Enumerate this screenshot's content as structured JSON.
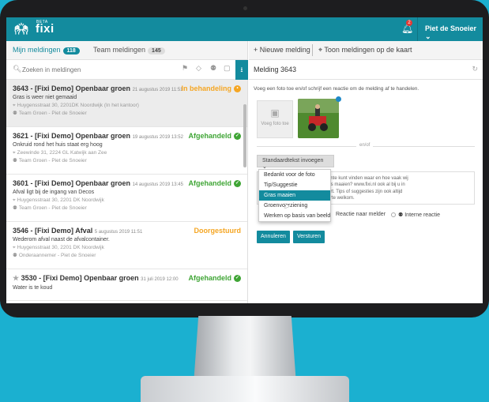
{
  "app": {
    "logo": "fixi",
    "beta": "BETA",
    "user": "Piet de Snoeier ⌄",
    "notification_count": "2"
  },
  "tabs": [
    {
      "label": "Mijn meldingen",
      "count": "118"
    },
    {
      "label": "Team meldingen",
      "count": "145"
    }
  ],
  "search": {
    "placeholder": "Zoeken in meldingen"
  },
  "items": [
    {
      "title": "3643 - [Fixi Demo] Openbaar groen",
      "date": "21 augustus 2019 11:51",
      "status": "In behandeling",
      "desc": "Gras is weer niet gemaaid",
      "address": "Huygensstraat 30, 2201DK Noordwijk (In het kantoor)",
      "team": "Team Groen - Piet de Snoeier"
    },
    {
      "title": "3621 - [Fixi Demo] Openbaar groen",
      "date": "19 augustus 2019 13:52",
      "status": "Afgehandeld",
      "desc": "Onkruid rond het huis staat erg hoog",
      "address": "Zeewinde 31, 2224 GL Katwijk aan Zee",
      "team": "Team Groen - Piet de Snoeier"
    },
    {
      "title": "3601 - [Fixi Demo] Openbaar groen",
      "date": "14 augustus 2019 13:45",
      "status": "Afgehandeld",
      "desc": "Afval ligt bij de ingang van Decos",
      "address": "Huygensstraat 30, 2201 DK Noordwijk",
      "team": "Team Groen - Piet de Snoeier"
    },
    {
      "title": "3546 - [Fixi Demo] Afval",
      "date": "5 augustus 2019 11:51",
      "status": "Doorgestuurd",
      "desc": "Wederom afval naast de afvalcontainer.",
      "address": "Huygensstraat 30, 2201 DK Noordwijk",
      "team": "Onderaannemer - Piet de Snoeier"
    },
    {
      "title": "3530 - [Fixi Demo] Openbaar groen",
      "date": "31 juli 2019 12:00",
      "status": "Afgehandeld",
      "desc": "Water is te koud",
      "address": "",
      "team": ""
    }
  ],
  "right": {
    "new_report": "Nieuwe melding",
    "show_map": "Toon meldingen op de kaart",
    "detail_title": "Melding 3643",
    "hint": "Voeg een foto toe en/of schrijf een reactie om de melding af te handelen.",
    "add_photo": "Voeg foto toe",
    "or": "en/of",
    "std_text": "Standaardtekst invoegen ⌄",
    "textarea_text": "gemeente kunt vinden waar en hoe vaak wij het gras maaien? www.fixi.nl ook al bij u in de buurt. Tips of suggesties zijn ook altijd van harte welkom.",
    "radio1": "Reactie naar melder",
    "radio2": "Interne reactie",
    "btn_annuleren": "Annuleren",
    "btn_versturen": "Versturen",
    "dropdown": [
      "Bedankt voor de foto",
      "Tip/Suggestie",
      "Gras maaien",
      "Groenvoorziening",
      "Werken op basis van beeld"
    ]
  },
  "colors": {
    "accent": "#138b9e",
    "orange": "#f5a623",
    "green": "#3fa535",
    "background": "#1bb0d0"
  }
}
